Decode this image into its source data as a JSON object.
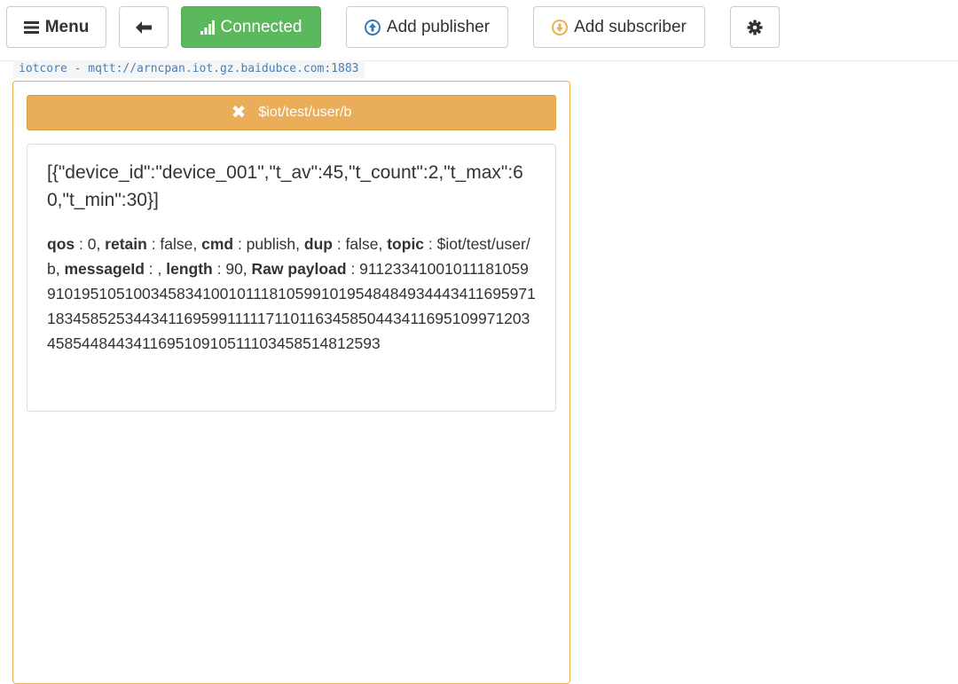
{
  "toolbar": {
    "menu_label": "Menu",
    "back_icon": "arrow-left-icon",
    "connected_label": "Connected",
    "add_publisher_label": "Add publisher",
    "add_subscriber_label": "Add subscriber",
    "settings_icon": "gear-icon",
    "colors": {
      "connected_bg": "#5cb85c",
      "publisher_icon": "#337ab7",
      "subscriber_icon": "#f0ad4e"
    }
  },
  "connection": {
    "label": "iotcore - mqtt://arncpan.iot.gz.baidubce.com:1883"
  },
  "subscription": {
    "topic": "$iot/test/user/b",
    "color": "#f0ad4e"
  },
  "message": {
    "payload": "[{\"device_id\":\"device_001\",\"t_av\":45,\"t_count\":2,\"t_max\":60,\"t_min\":30}]",
    "fields": [
      {
        "key": "qos",
        "value": " : 0, "
      },
      {
        "key": "retain",
        "value": " : false, "
      },
      {
        "key": "cmd",
        "value": " : publish, "
      },
      {
        "key": "dup",
        "value": " : false, "
      },
      {
        "key": "topic",
        "value": " : $iot/test/user/b, "
      },
      {
        "key": "messageId",
        "value": " : , "
      },
      {
        "key": "length",
        "value": " : 90, "
      },
      {
        "key": "Raw payload",
        "value": " : 91123341001011181059910195105100345834100101118105991019548484934443411695971183458525344341169599111117110116345850443411695109971203458544844341169510910511103458514812593"
      }
    ]
  }
}
